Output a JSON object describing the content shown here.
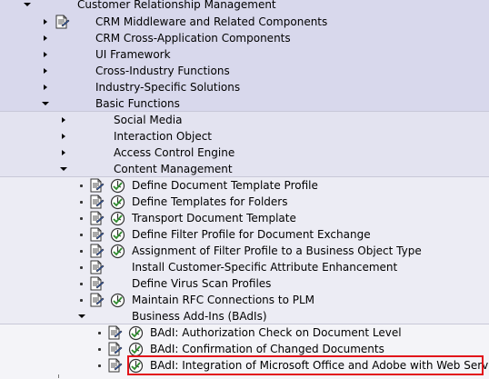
{
  "tree": {
    "root": {
      "label": "Customer Relationship Management"
    },
    "level1": [
      {
        "label": "CRM Middleware and Related Components"
      },
      {
        "label": "CRM Cross-Application Components"
      },
      {
        "label": "UI Framework"
      },
      {
        "label": "Cross-Industry Functions"
      },
      {
        "label": "Industry-Specific Solutions"
      },
      {
        "label": "Basic Functions"
      }
    ],
    "level2": [
      {
        "label": "Social Media"
      },
      {
        "label": "Interaction Object"
      },
      {
        "label": "Access Control Engine"
      },
      {
        "label": "Content Management"
      }
    ],
    "content_management": [
      {
        "label": "Define Document Template Profile"
      },
      {
        "label": "Define Templates for Folders"
      },
      {
        "label": "Transport Document Template"
      },
      {
        "label": "Define Filter Profile for Document Exchange"
      },
      {
        "label": "Assignment of Filter Profile to a Business Object Type"
      },
      {
        "label": "Install Customer-Specific Attribute Enhancement"
      },
      {
        "label": "Define Virus Scan Profiles"
      },
      {
        "label": "Maintain RFC Connections to PLM"
      },
      {
        "label": "Business Add-Ins (BAdIs)"
      }
    ],
    "badis": [
      {
        "label": "BAdI: Authorization Check on Document Level"
      },
      {
        "label": "BAdI: Confirmation of Changed Documents"
      },
      {
        "label": "BAdI: Integration of Microsoft Office and Adobe with Web Service"
      }
    ]
  },
  "colors": {
    "highlight": "#e2141b",
    "clock_green": "#2e8b2e"
  }
}
